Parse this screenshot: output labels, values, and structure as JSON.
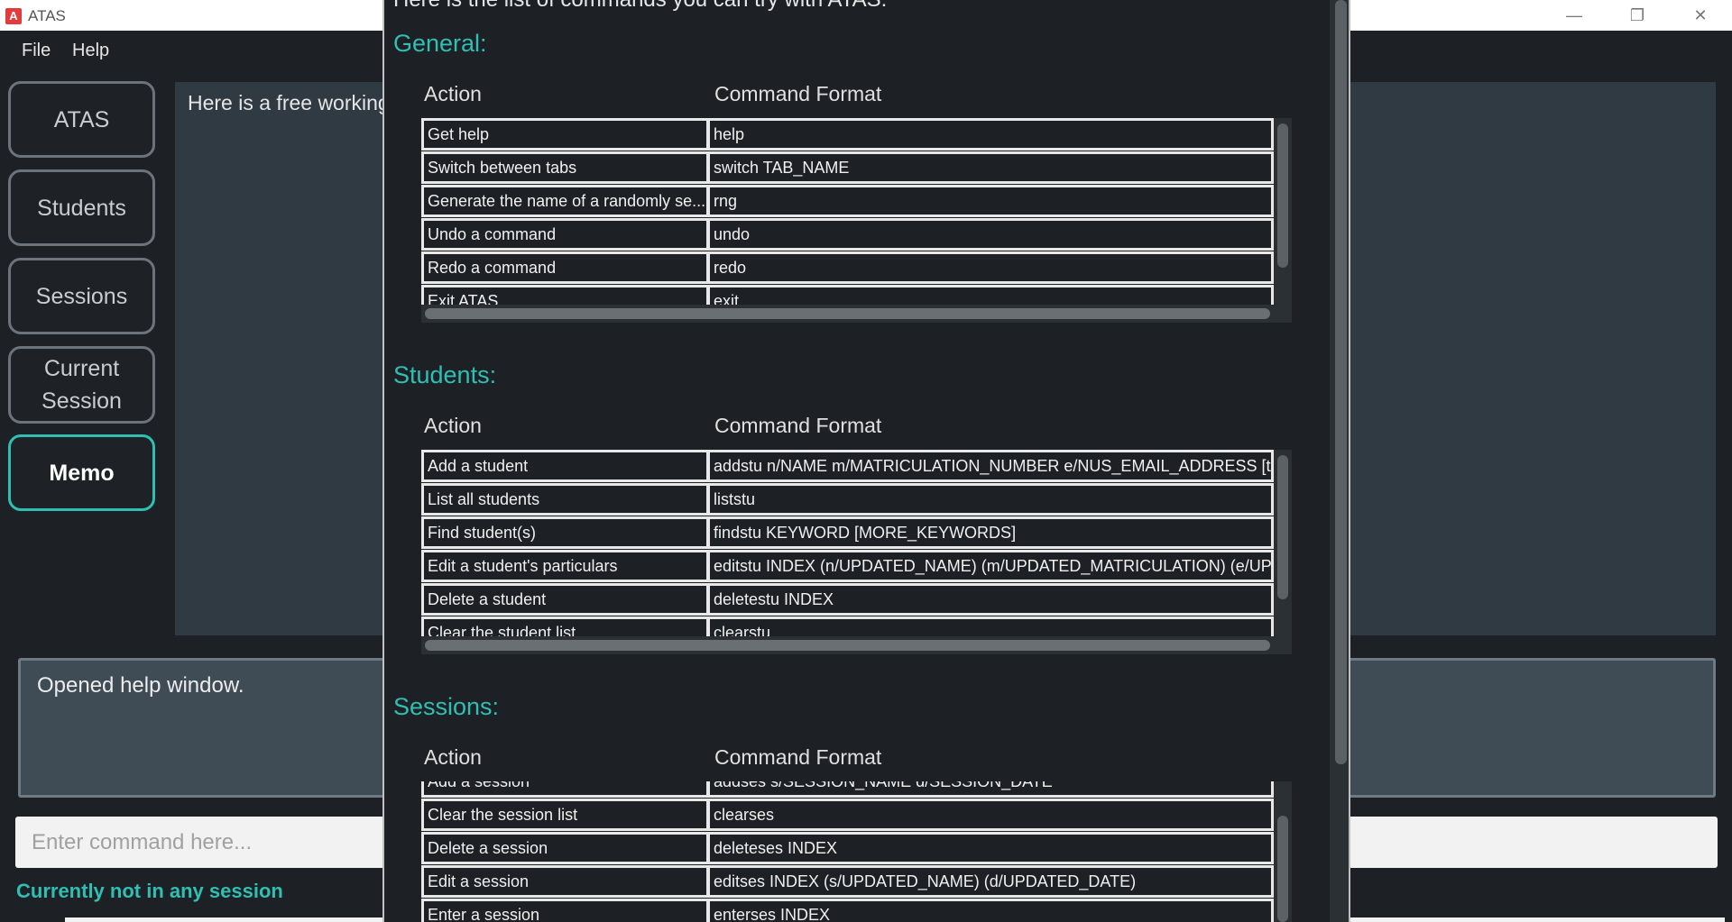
{
  "window": {
    "title": "ATAS",
    "icon_letter": "A"
  },
  "menu": {
    "file": "File",
    "help": "Help"
  },
  "tabs": [
    {
      "label": "ATAS"
    },
    {
      "label": "Students"
    },
    {
      "label": "Sessions"
    },
    {
      "label": "Current Session"
    },
    {
      "label": "Memo",
      "active": true
    }
  ],
  "memo": {
    "text": "Here is a free working"
  },
  "result": {
    "text": "Opened help window."
  },
  "command": {
    "placeholder": "Enter command here..."
  },
  "status": {
    "session": "Currently not in any session"
  },
  "help_window": {
    "intro": "Here is the list of commands you can try with ATAS:",
    "sections": [
      {
        "title": "General:",
        "action_header": "Action",
        "format_header": "Command Format",
        "rows": [
          {
            "action": "Get help",
            "format": "help"
          },
          {
            "action": "Switch between tabs",
            "format": "switch TAB_NAME"
          },
          {
            "action": "Generate the name of a randomly se...",
            "format": "rng"
          },
          {
            "action": "Undo a command",
            "format": "undo"
          },
          {
            "action": "Redo a command",
            "format": "redo"
          },
          {
            "action": "Exit ATAS",
            "format": "exit"
          }
        ]
      },
      {
        "title": "Students:",
        "action_header": "Action",
        "format_header": "Command Format",
        "rows": [
          {
            "action": "Add a student",
            "format": "addstu n/NAME m/MATRICULATION_NUMBER e/NUS_EMAIL_ADDRESS [t/..."
          },
          {
            "action": "List all students",
            "format": "liststu"
          },
          {
            "action": "Find student(s)",
            "format": "findstu KEYWORD [MORE_KEYWORDS]"
          },
          {
            "action": "Edit a student's particulars",
            "format": "editstu INDEX (n/UPDATED_NAME) (m/UPDATED_MATRICULATION) (e/UP..."
          },
          {
            "action": "Delete a student",
            "format": "deletestu INDEX"
          },
          {
            "action": "Clear the student list",
            "format": "clearstu"
          }
        ]
      },
      {
        "title": "Sessions:",
        "action_header": "Action",
        "format_header": "Command Format",
        "rows": [
          {
            "action": "Add a session",
            "format": "addses s/SESSION_NAME d/SESSION_DATE"
          },
          {
            "action": "Clear the session list",
            "format": "clearses"
          },
          {
            "action": "Delete a session",
            "format": "deleteses INDEX"
          },
          {
            "action": "Edit a session",
            "format": "editses INDEX (s/UPDATED_NAME) (d/UPDATED_DATE)"
          },
          {
            "action": "Enter a session",
            "format": "enterses INDEX"
          }
        ]
      }
    ]
  },
  "colors": {
    "accent": "#2fbfb3",
    "background": "#1d2125",
    "panel": "#2f3a42"
  }
}
